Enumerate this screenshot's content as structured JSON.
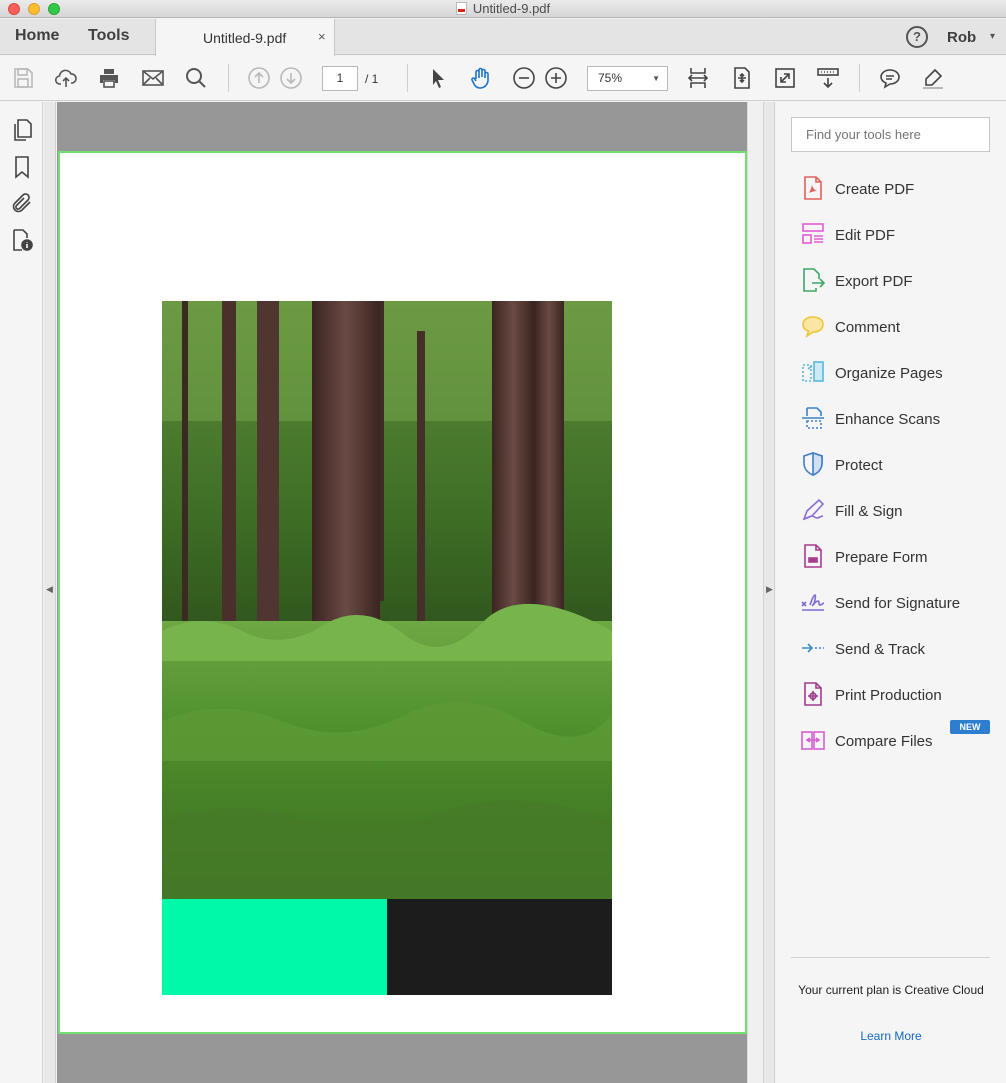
{
  "window": {
    "title": "Untitled-9.pdf"
  },
  "tabs": {
    "home": "Home",
    "tools": "Tools",
    "document": "Untitled-9.pdf",
    "close_glyph": "×"
  },
  "user": {
    "help_glyph": "?",
    "name": "Rob",
    "caret": "▾"
  },
  "toolbar": {
    "page_current": "1",
    "page_total": "/ 1",
    "zoom": "75%",
    "zoom_caret": "▼",
    "icons": [
      "save-icon",
      "cloud-upload-icon",
      "print-icon",
      "email-icon",
      "search-icon",
      "prev-page-icon",
      "next-page-icon",
      "select-arrow-icon",
      "hand-icon",
      "zoom-out-icon",
      "zoom-in-icon",
      "fit-width-icon",
      "fit-page-icon",
      "full-screen-icon",
      "scroll-mode-icon",
      "comment-icon",
      "highlight-icon"
    ]
  },
  "left_panel": {
    "icons": [
      "page-thumbnails-icon",
      "bookmarks-icon",
      "attachments-icon",
      "document-properties-icon"
    ],
    "collapse_glyph": "◀"
  },
  "right_collapse_glyph": "▶",
  "document": {
    "page_count": 1,
    "swatch_colors": [
      "#00f9a9",
      "#1c1c1c"
    ]
  },
  "tools_pane": {
    "search_placeholder": "Find your tools here",
    "items": [
      {
        "label": "Create PDF",
        "icon": "create-pdf-icon",
        "color": "#e0615a"
      },
      {
        "label": "Edit PDF",
        "icon": "edit-pdf-icon",
        "color": "#e45bd9"
      },
      {
        "label": "Export PDF",
        "icon": "export-pdf-icon",
        "color": "#3ea76a"
      },
      {
        "label": "Comment",
        "icon": "comment-icon",
        "color": "#f0c53a"
      },
      {
        "label": "Organize Pages",
        "icon": "organize-pages-icon",
        "color": "#59b8d8"
      },
      {
        "label": "Enhance Scans",
        "icon": "enhance-scans-icon",
        "color": "#3d84c7"
      },
      {
        "label": "Protect",
        "icon": "protect-icon",
        "color": "#3f7fc7"
      },
      {
        "label": "Fill & Sign",
        "icon": "fill-sign-icon",
        "color": "#8a6cd4"
      },
      {
        "label": "Prepare Form",
        "icon": "prepare-form-icon",
        "color": "#a83c8e"
      },
      {
        "label": "Send for Signature",
        "icon": "send-signature-icon",
        "color": "#7f6ad1"
      },
      {
        "label": "Send & Track",
        "icon": "send-track-icon",
        "color": "#3a8fc9"
      },
      {
        "label": "Print Production",
        "icon": "print-production-icon",
        "color": "#a03c8c"
      },
      {
        "label": "Compare Files",
        "icon": "compare-files-icon",
        "color": "#d65fd1"
      }
    ],
    "new_badge": "NEW",
    "plan_text": "Your current plan is Creative Cloud",
    "learn_more": "Learn More"
  }
}
